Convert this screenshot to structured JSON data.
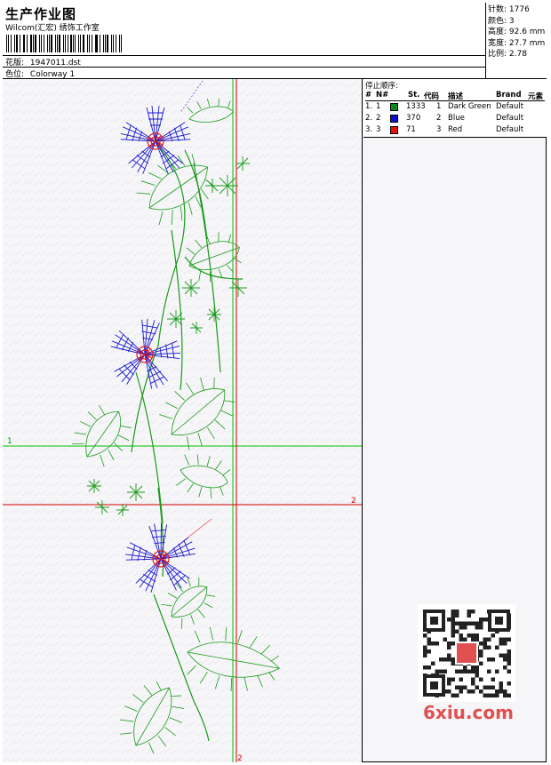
{
  "header": {
    "title": "生产作业图",
    "company": "Wilcom(汇宏) 绣饰工作室",
    "design_label": "花版:",
    "design_value": "1947011.dst",
    "colorway_label": "色位:",
    "colorway_value": "Colorway 1"
  },
  "stats": {
    "stitches": "针数: 1776",
    "colors": "颜色: 3",
    "height": "高度: 92.6 mm",
    "width": "宽度: 27.7 mm",
    "ratio": "比例: 2.78"
  },
  "stop_sequence": {
    "title": "停止顺序:",
    "headers": [
      "#",
      "N#",
      "St.",
      "代码",
      "描述",
      "Brand",
      "元素"
    ],
    "rows": [
      {
        "idx": "1.",
        "n": "1",
        "color": "#0a8a1a",
        "st": "1333",
        "code": "1",
        "desc": "Dark Green",
        "brand": "Default"
      },
      {
        "idx": "2.",
        "n": "2",
        "color": "#1010d0",
        "st": "370",
        "code": "2",
        "desc": "Blue",
        "brand": "Default"
      },
      {
        "idx": "3.",
        "n": "3",
        "color": "#e01010",
        "st": "71",
        "code": "3",
        "desc": "Red",
        "brand": "Default"
      }
    ]
  },
  "guides": {
    "label_1": "1",
    "label_2": "2"
  },
  "watermark": "6xiu.com",
  "colors": {
    "green": "#1a9a1a",
    "blue": "#1a1ad0",
    "red": "#e01818",
    "guide_green": "#00c000",
    "guide_red": "#d00000"
  }
}
